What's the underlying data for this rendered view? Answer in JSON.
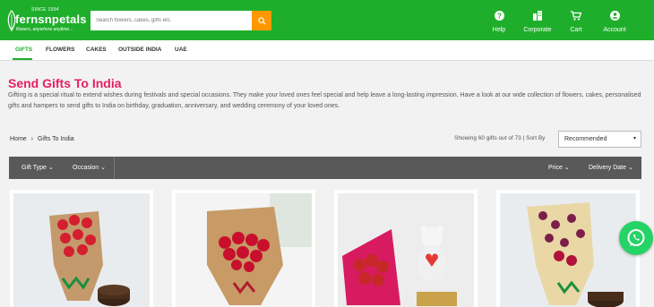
{
  "header": {
    "logo": {
      "since": "SINCE 1994",
      "brand": "fernsnpetals",
      "tagline": "flowers, anywhere anytime..."
    },
    "search_placeholder": "Search flowers, cakes, gifts etc.",
    "nav": [
      {
        "label": "Help",
        "icon": "help-icon"
      },
      {
        "label": "Corporate",
        "icon": "corporate-icon"
      },
      {
        "label": "Cart",
        "icon": "cart-icon"
      },
      {
        "label": "Account",
        "icon": "account-icon"
      }
    ]
  },
  "categories": [
    "GIFTS",
    "FLOWERS",
    "CAKES",
    "OUTSIDE INDIA",
    "UAE"
  ],
  "active_category": "GIFTS",
  "intro": {
    "title": "Send Gifts To India",
    "description": "Gifting is a special ritual to extend wishes during festivals and special occasions. They make your loved ones feel special and help leave a long-lasting impression. Have a look at our wide collection of flowers, cakes, personalised gifts and hampers to send gifts to India on birthday, graduation, anniversary, and wedding ceremony of your loved ones."
  },
  "breadcrumb": {
    "home": "Home",
    "separator": "›",
    "current": "Gifts To India"
  },
  "listing": {
    "showing": "Showing 60 gifts out of 73 |",
    "sort_label": "Sort By",
    "sort_value": "Recommended"
  },
  "filters": {
    "left": [
      {
        "label": "Gift Type"
      },
      {
        "label": "Occasion"
      }
    ],
    "right": [
      {
        "label": "Price"
      },
      {
        "label": "Delivery Date"
      }
    ]
  },
  "products": [
    {
      "name": "red-roses-bouquet-with-cake"
    },
    {
      "name": "red-roses-bouquet"
    },
    {
      "name": "roses-teddy-chocolates-combo"
    },
    {
      "name": "orchids-lilies-bouquet-with-cake"
    }
  ],
  "colors": {
    "brand_green": "#1fae2b",
    "accent_orange": "#ff9800",
    "title_pink": "#e91e63",
    "filter_bar": "#595959",
    "whatsapp": "#25d366"
  }
}
